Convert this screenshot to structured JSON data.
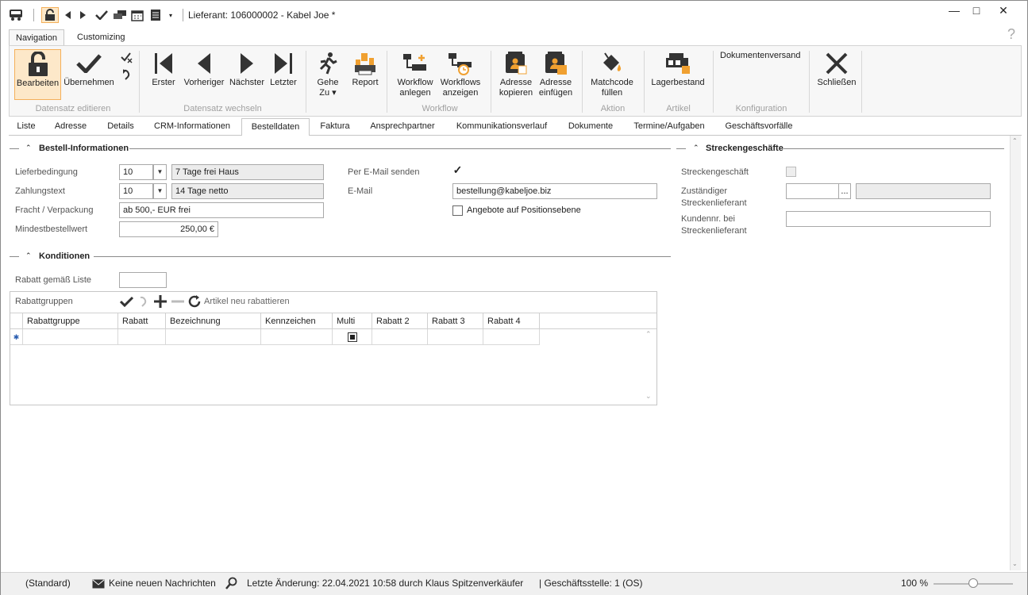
{
  "window": {
    "title": "Lieferant: 106000002 - Kabel Joe *",
    "min": "—",
    "max": "□",
    "close": "✕"
  },
  "ribbon_tabs": [
    {
      "label": "Navigation"
    },
    {
      "label": "Customizing"
    }
  ],
  "help": "?",
  "ribbon": {
    "bearbeiten": "Bearbeiten",
    "uebernehmen": "Übernehmen",
    "erster": "Erster",
    "vorheriger": "Vorheriger",
    "naechster": "Nächster",
    "letzter": "Letzter",
    "gehe": "Gehe",
    "zu": "Zu ▾",
    "report": "Report",
    "wf_anlegen_1": "Workflow",
    "wf_anlegen_2": "anlegen",
    "wf_anzeigen_1": "Workflows",
    "wf_anzeigen_2": "anzeigen",
    "adr_kop_1": "Adresse",
    "adr_kop_2": "kopieren",
    "adr_einf_1": "Adresse",
    "adr_einf_2": "einfügen",
    "match_1": "Matchcode",
    "match_2": "füllen",
    "lager": "Lagerbestand",
    "dokversand": "Dokumentenversand",
    "schliessen": "Schließen",
    "groups": {
      "datensatz_edit": "Datensatz editieren",
      "datensatz_wechseln": "Datensatz wechseln",
      "workflow": "Workflow",
      "aktion": "Aktion",
      "artikel": "Artikel",
      "konfiguration": "Konfiguration"
    }
  },
  "tabs": [
    "Liste",
    "Adresse",
    "Details",
    "CRM-Informationen",
    "Bestelldaten",
    "Faktura",
    "Ansprechpartner",
    "Kommunikationsverlauf",
    "Dokumente",
    "Termine/Aufgaben",
    "Geschäftsvorfälle"
  ],
  "bestell": {
    "title": "Bestell-Informationen",
    "lieferbedingung_label": "Lieferbedingung",
    "lieferbedingung_code": "10",
    "lieferbedingung_text": "7 Tage frei Haus",
    "zahlung_label": "Zahlungstext",
    "zahlung_code": "10",
    "zahlung_text": "14 Tage netto",
    "fracht_label": "Fracht / Verpackung",
    "fracht_value": "ab 500,- EUR frei",
    "mindest_label": "Mindestbestellwert",
    "mindest_value": "250,00 €",
    "email_send_label": "Per E-Mail senden",
    "email_check": "✓",
    "email_label": "E-Mail",
    "email_value": "bestellung@kabeljoe.biz",
    "angebote_label": "Angebote auf Positionsebene"
  },
  "strecken": {
    "title": "Streckengeschäfte",
    "geschaeft_label": "Streckengeschäft",
    "zust_1": "Zuständiger",
    "zust_2": "Streckenlieferant",
    "ellipsis": "...",
    "kunden_1": "Kundennr. bei",
    "kunden_2": "Streckenlieferant"
  },
  "konditionen": {
    "title": "Konditionen",
    "rabatt_liste_label": "Rabatt gemäß Liste",
    "rabattgruppen_label": "Rabattgruppen",
    "neu_rabattieren": "Artikel neu rabattieren",
    "columns": [
      "Rabattgruppe",
      "Rabatt",
      "Bezeichnung",
      "Kennzeichen",
      "Multi",
      "Rabatt 2",
      "Rabatt 3",
      "Rabatt 4"
    ],
    "new_row_marker": "✱"
  },
  "status": {
    "standard": "(Standard)",
    "nachrichten": "Keine neuen Nachrichten",
    "aenderung": "Letzte Änderung: 22.04.2021 10:58 durch Klaus Spitzenverkäufer",
    "stelle": "| Geschäftsstelle: 1 (OS)",
    "zoom": "100 %"
  }
}
